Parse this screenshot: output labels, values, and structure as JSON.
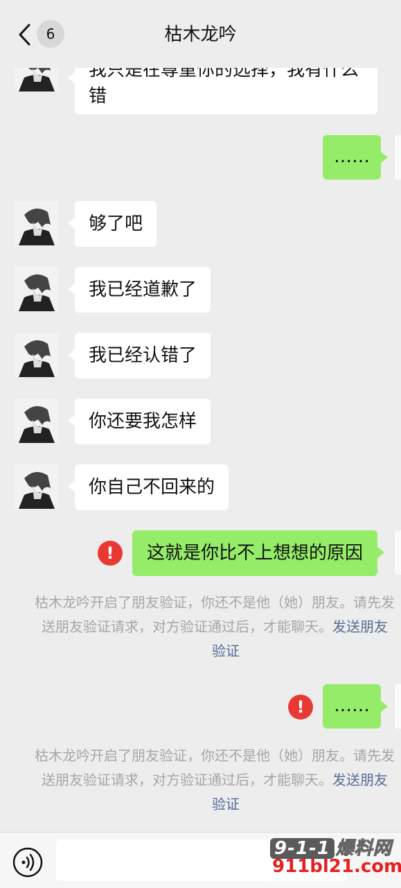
{
  "header": {
    "back_count": "6",
    "title": "枯木龙吟"
  },
  "messages": {
    "m1": "我只是在尊重你的选择，我有什么\n错",
    "m2": "……",
    "m3": "够了吧",
    "m4": "我已经道歉了",
    "m5": "我已经认错了",
    "m6": "你还要我怎样",
    "m7": "你自己不回来的",
    "m8": "这就是你比不上想想的原因",
    "m9": "……"
  },
  "error_mark": "!",
  "system_notice": {
    "line1": "枯木龙吟开启了朋友验证，你还不是他（她）朋友。请先发",
    "line2_prefix": "送朋友验证请求，对方验证通过后，才能聊天。",
    "line2_link": "发送朋友",
    "line3_link": "验证"
  },
  "watermark": {
    "top_number": "9-1-1",
    "top_text": "爆料网",
    "bottom_text": "911bl21.com"
  },
  "colors": {
    "background": "#ededed",
    "self_bubble": "#95ec69",
    "other_bubble": "#ffffff",
    "error": "#e83a33",
    "link": "#576b95"
  }
}
